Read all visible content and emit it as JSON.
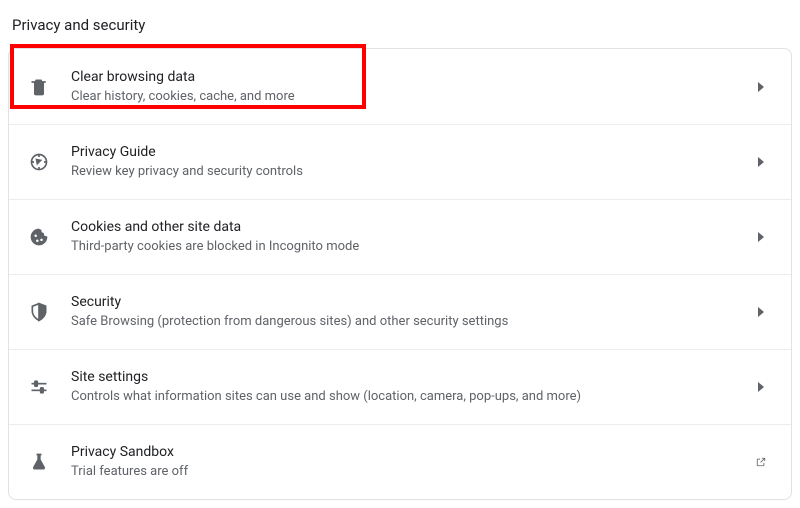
{
  "page": {
    "title": "Privacy and security"
  },
  "items": [
    {
      "icon": "trash-icon",
      "title": "Clear browsing data",
      "subtitle": "Clear history, cookies, cache, and more",
      "action_icon": "chevron-right-icon",
      "highlighted": true
    },
    {
      "icon": "compass-icon",
      "title": "Privacy Guide",
      "subtitle": "Review key privacy and security controls",
      "action_icon": "chevron-right-icon"
    },
    {
      "icon": "cookie-icon",
      "title": "Cookies and other site data",
      "subtitle": "Third-party cookies are blocked in Incognito mode",
      "action_icon": "chevron-right-icon"
    },
    {
      "icon": "shield-icon",
      "title": "Security",
      "subtitle": "Safe Browsing (protection from dangerous sites) and other security settings",
      "action_icon": "chevron-right-icon"
    },
    {
      "icon": "sliders-icon",
      "title": "Site settings",
      "subtitle": "Controls what information sites can use and show (location, camera, pop-ups, and more)",
      "action_icon": "chevron-right-icon"
    },
    {
      "icon": "flask-icon",
      "title": "Privacy Sandbox",
      "subtitle": "Trial features are off",
      "action_icon": "open-external-icon"
    }
  ],
  "annotation": {
    "highlight_color": "#ff0000"
  }
}
